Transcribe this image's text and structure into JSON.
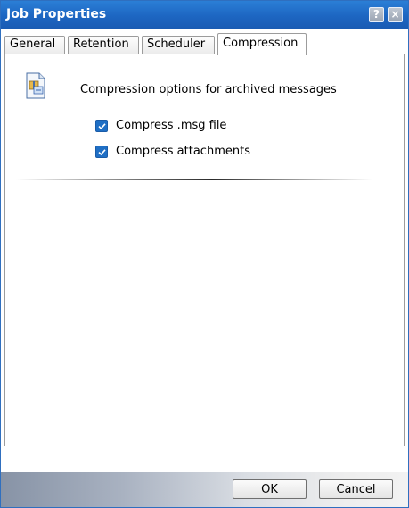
{
  "window": {
    "title": "Job Properties",
    "help_glyph": "?",
    "close_glyph": "×"
  },
  "tabs": [
    {
      "label": "General",
      "active": false
    },
    {
      "label": "Retention",
      "active": false
    },
    {
      "label": "Scheduler",
      "active": false
    },
    {
      "label": "Compression",
      "active": true
    }
  ],
  "compression": {
    "icon": "compressed-document-icon",
    "description": "Compression options for archived messages",
    "options": [
      {
        "label": "Compress .msg file",
        "checked": true
      },
      {
        "label": "Compress attachments",
        "checked": true
      }
    ]
  },
  "buttons": {
    "ok": "OK",
    "cancel": "Cancel"
  },
  "colors": {
    "titlebar": "#1d66c2",
    "checkbox_checked": "#1f6fc5"
  }
}
